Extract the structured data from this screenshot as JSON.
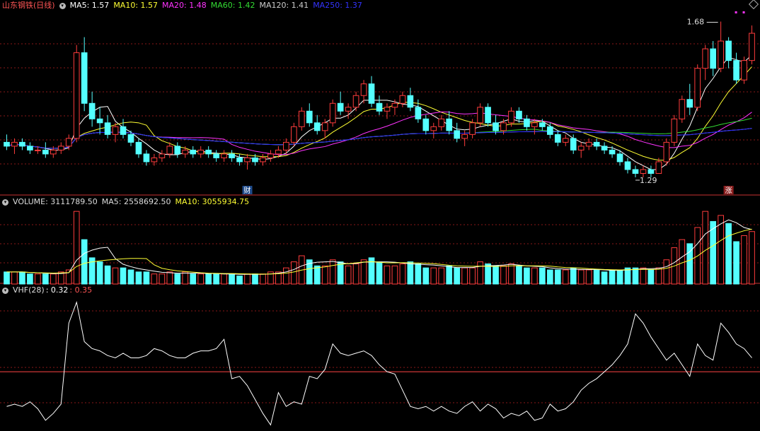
{
  "colors": {
    "background": "#000000",
    "grid": "#8a1818",
    "panel_border": "#c83232",
    "up": "#ff3c3c",
    "down": "#54ffff",
    "ma5": "#ffffff",
    "ma10": "#ffff33",
    "ma20": "#ff33ff",
    "ma60": "#33dd33",
    "ma120": "#cccccc",
    "ma250": "#2222ff",
    "vhf": "#ffffff",
    "vhf_level": "#ff4444"
  },
  "price_panel": {
    "title": "山东钢铁(日线)",
    "ma_labels": [
      {
        "text": "MA5: 1.57",
        "color": "#ffffff"
      },
      {
        "text": "MA10: 1.57",
        "color": "#ffff33"
      },
      {
        "text": "MA20: 1.48",
        "color": "#ff33ff"
      },
      {
        "text": "MA60: 1.42",
        "color": "#33dd33"
      },
      {
        "text": "MA120: 1.41",
        "color": "#cccccc"
      },
      {
        "text": "MA250: 1.37",
        "color": "#3333ff"
      }
    ],
    "high_label": "1.68",
    "low_label": "1.29",
    "marker_cai": "财",
    "marker_zhang": "涨"
  },
  "volume_panel": {
    "labels": [
      {
        "text": "VOLUME: 3111789.50",
        "color": "#dddddd"
      },
      {
        "text": "MA5: 2558692.50",
        "color": "#dddddd"
      },
      {
        "text": "MA10: 3055934.75",
        "color": "#ffff33"
      }
    ]
  },
  "vhf_panel": {
    "labels": [
      {
        "text": "VHF(28)",
        "color": "#dddddd"
      },
      {
        "text": ": 0.32",
        "color": "#ffffff"
      },
      {
        "text": ": 0.35",
        "color": "#ff5555"
      }
    ]
  },
  "chart_data": {
    "type": "candlestick",
    "price_range": [
      1.26,
      1.71
    ],
    "candles": [
      [
        1.37,
        1.39,
        1.35,
        1.36
      ],
      [
        1.36,
        1.38,
        1.34,
        1.37
      ],
      [
        1.37,
        1.38,
        1.35,
        1.36
      ],
      [
        1.36,
        1.37,
        1.34,
        1.35
      ],
      [
        1.35,
        1.36,
        1.34,
        1.35
      ],
      [
        1.35,
        1.37,
        1.33,
        1.34
      ],
      [
        1.34,
        1.36,
        1.33,
        1.35
      ],
      [
        1.35,
        1.37,
        1.34,
        1.36
      ],
      [
        1.36,
        1.39,
        1.35,
        1.38
      ],
      [
        1.38,
        1.62,
        1.37,
        1.6
      ],
      [
        1.6,
        1.64,
        1.45,
        1.47
      ],
      [
        1.47,
        1.5,
        1.41,
        1.43
      ],
      [
        1.43,
        1.46,
        1.39,
        1.42
      ],
      [
        1.42,
        1.44,
        1.38,
        1.39
      ],
      [
        1.39,
        1.42,
        1.37,
        1.41
      ],
      [
        1.41,
        1.43,
        1.38,
        1.39
      ],
      [
        1.39,
        1.4,
        1.36,
        1.37
      ],
      [
        1.37,
        1.38,
        1.33,
        1.34
      ],
      [
        1.34,
        1.35,
        1.31,
        1.32
      ],
      [
        1.32,
        1.34,
        1.31,
        1.33
      ],
      [
        1.33,
        1.35,
        1.32,
        1.34
      ],
      [
        1.34,
        1.37,
        1.33,
        1.36
      ],
      [
        1.36,
        1.37,
        1.33,
        1.34
      ],
      [
        1.34,
        1.36,
        1.33,
        1.35
      ],
      [
        1.35,
        1.36,
        1.33,
        1.34
      ],
      [
        1.34,
        1.36,
        1.33,
        1.35
      ],
      [
        1.35,
        1.36,
        1.33,
        1.34
      ],
      [
        1.34,
        1.35,
        1.32,
        1.33
      ],
      [
        1.33,
        1.35,
        1.32,
        1.34
      ],
      [
        1.34,
        1.35,
        1.32,
        1.33
      ],
      [
        1.33,
        1.34,
        1.31,
        1.32
      ],
      [
        1.32,
        1.34,
        1.3,
        1.33
      ],
      [
        1.33,
        1.34,
        1.31,
        1.32
      ],
      [
        1.32,
        1.34,
        1.31,
        1.33
      ],
      [
        1.33,
        1.35,
        1.32,
        1.34
      ],
      [
        1.34,
        1.36,
        1.33,
        1.35
      ],
      [
        1.35,
        1.38,
        1.34,
        1.37
      ],
      [
        1.37,
        1.42,
        1.36,
        1.41
      ],
      [
        1.41,
        1.46,
        1.4,
        1.45
      ],
      [
        1.45,
        1.47,
        1.41,
        1.42
      ],
      [
        1.42,
        1.44,
        1.39,
        1.4
      ],
      [
        1.4,
        1.43,
        1.38,
        1.42
      ],
      [
        1.42,
        1.48,
        1.41,
        1.47
      ],
      [
        1.47,
        1.5,
        1.44,
        1.45
      ],
      [
        1.45,
        1.47,
        1.43,
        1.46
      ],
      [
        1.46,
        1.5,
        1.45,
        1.49
      ],
      [
        1.49,
        1.53,
        1.47,
        1.52
      ],
      [
        1.52,
        1.54,
        1.46,
        1.47
      ],
      [
        1.47,
        1.49,
        1.44,
        1.45
      ],
      [
        1.45,
        1.47,
        1.43,
        1.46
      ],
      [
        1.46,
        1.48,
        1.44,
        1.47
      ],
      [
        1.47,
        1.5,
        1.46,
        1.49
      ],
      [
        1.49,
        1.51,
        1.45,
        1.46
      ],
      [
        1.46,
        1.48,
        1.42,
        1.43
      ],
      [
        1.43,
        1.44,
        1.39,
        1.4
      ],
      [
        1.4,
        1.42,
        1.38,
        1.41
      ],
      [
        1.41,
        1.44,
        1.4,
        1.43
      ],
      [
        1.43,
        1.45,
        1.39,
        1.4
      ],
      [
        1.4,
        1.42,
        1.37,
        1.38
      ],
      [
        1.38,
        1.4,
        1.36,
        1.39
      ],
      [
        1.39,
        1.43,
        1.38,
        1.42
      ],
      [
        1.42,
        1.47,
        1.41,
        1.46
      ],
      [
        1.46,
        1.47,
        1.41,
        1.42
      ],
      [
        1.42,
        1.44,
        1.39,
        1.4
      ],
      [
        1.4,
        1.43,
        1.39,
        1.42
      ],
      [
        1.42,
        1.46,
        1.41,
        1.45
      ],
      [
        1.45,
        1.46,
        1.42,
        1.43
      ],
      [
        1.43,
        1.44,
        1.4,
        1.41
      ],
      [
        1.41,
        1.43,
        1.39,
        1.42
      ],
      [
        1.42,
        1.43,
        1.4,
        1.41
      ],
      [
        1.41,
        1.42,
        1.38,
        1.39
      ],
      [
        1.39,
        1.4,
        1.36,
        1.37
      ],
      [
        1.37,
        1.39,
        1.36,
        1.38
      ],
      [
        1.38,
        1.39,
        1.34,
        1.35
      ],
      [
        1.35,
        1.37,
        1.33,
        1.36
      ],
      [
        1.36,
        1.38,
        1.35,
        1.37
      ],
      [
        1.37,
        1.38,
        1.35,
        1.36
      ],
      [
        1.36,
        1.37,
        1.34,
        1.35
      ],
      [
        1.35,
        1.36,
        1.33,
        1.34
      ],
      [
        1.34,
        1.35,
        1.31,
        1.32
      ],
      [
        1.32,
        1.33,
        1.29,
        1.3
      ],
      [
        1.3,
        1.31,
        1.28,
        1.29
      ],
      [
        1.29,
        1.31,
        1.28,
        1.3
      ],
      [
        1.3,
        1.31,
        1.28,
        1.29
      ],
      [
        1.29,
        1.33,
        1.29,
        1.32
      ],
      [
        1.32,
        1.38,
        1.31,
        1.37
      ],
      [
        1.37,
        1.44,
        1.36,
        1.43
      ],
      [
        1.43,
        1.49,
        1.42,
        1.48
      ],
      [
        1.48,
        1.52,
        1.44,
        1.46
      ],
      [
        1.46,
        1.57,
        1.45,
        1.56
      ],
      [
        1.56,
        1.62,
        1.53,
        1.61
      ],
      [
        1.61,
        1.63,
        1.54,
        1.56
      ],
      [
        1.56,
        1.68,
        1.55,
        1.63
      ],
      [
        1.63,
        1.64,
        1.56,
        1.58
      ],
      [
        1.58,
        1.6,
        1.52,
        1.53
      ],
      [
        1.53,
        1.59,
        1.52,
        1.58
      ],
      [
        1.58,
        1.67,
        1.57,
        1.65
      ]
    ],
    "volume": [
      6,
      6,
      6,
      5,
      5,
      5,
      5,
      6,
      7,
      36,
      22,
      13,
      11,
      9,
      8,
      8,
      7,
      6,
      6,
      5,
      5,
      6,
      5,
      6,
      5,
      5,
      5,
      5,
      5,
      5,
      4,
      5,
      5,
      5,
      6,
      6,
      8,
      11,
      14,
      12,
      9,
      9,
      12,
      11,
      9,
      10,
      12,
      13,
      11,
      9,
      9,
      10,
      11,
      10,
      8,
      8,
      8,
      9,
      8,
      8,
      8,
      11,
      10,
      9,
      9,
      10,
      9,
      8,
      8,
      8,
      7,
      7,
      7,
      8,
      7,
      7,
      7,
      6,
      7,
      7,
      8,
      8,
      8,
      7,
      8,
      12,
      18,
      22,
      20,
      28,
      36,
      31,
      34,
      30,
      21,
      24,
      26
    ],
    "vhf": [
      0.2,
      0.21,
      0.2,
      0.22,
      0.19,
      0.14,
      0.17,
      0.21,
      0.56,
      0.65,
      0.48,
      0.45,
      0.44,
      0.42,
      0.41,
      0.43,
      0.41,
      0.41,
      0.42,
      0.45,
      0.44,
      0.42,
      0.41,
      0.41,
      0.43,
      0.44,
      0.44,
      0.45,
      0.49,
      0.32,
      0.33,
      0.29,
      0.23,
      0.17,
      0.12,
      0.26,
      0.2,
      0.22,
      0.21,
      0.33,
      0.32,
      0.36,
      0.47,
      0.43,
      0.42,
      0.43,
      0.44,
      0.42,
      0.38,
      0.35,
      0.34,
      0.27,
      0.2,
      0.19,
      0.2,
      0.18,
      0.2,
      0.18,
      0.17,
      0.2,
      0.22,
      0.18,
      0.21,
      0.19,
      0.15,
      0.17,
      0.16,
      0.18,
      0.14,
      0.15,
      0.21,
      0.18,
      0.19,
      0.22,
      0.27,
      0.3,
      0.32,
      0.35,
      0.38,
      0.42,
      0.47,
      0.6,
      0.56,
      0.5,
      0.45,
      0.4,
      0.43,
      0.38,
      0.33,
      0.47,
      0.42,
      0.4,
      0.56,
      0.52,
      0.47,
      0.45,
      0.41
    ],
    "vhf_level": 0.35,
    "vhf_range": [
      0.1,
      0.68
    ]
  }
}
